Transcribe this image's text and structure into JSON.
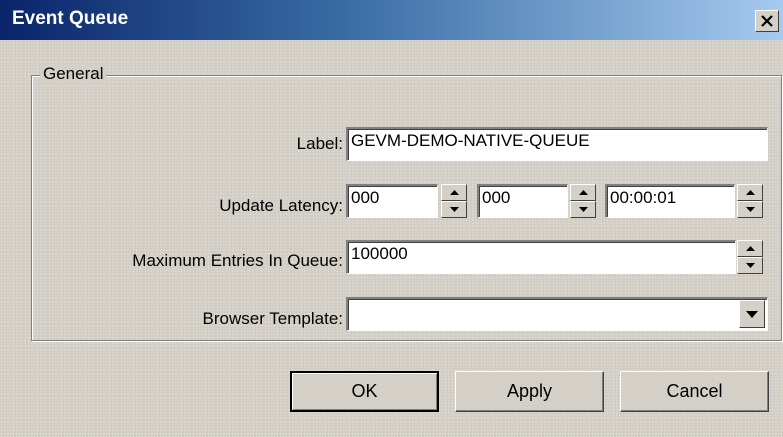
{
  "window": {
    "title": "Event Queue",
    "close_glyph": "✕"
  },
  "group": {
    "legend": "General"
  },
  "fields": {
    "label": {
      "label": "Label:",
      "value": "GEVM-DEMO-NATIVE-QUEUE"
    },
    "update_latency": {
      "label": "Update Latency:",
      "values": [
        "000",
        "000",
        "00:00:01"
      ]
    },
    "max_entries": {
      "label": "Maximum Entries In Queue:",
      "value": "100000"
    },
    "browser_template": {
      "label": "Browser Template:",
      "value": ""
    }
  },
  "buttons": {
    "ok": "OK",
    "apply": "Apply",
    "cancel": "Cancel"
  },
  "icons": {
    "spin_up": "up-arrow-icon",
    "spin_down": "down-arrow-icon",
    "dropdown": "chevron-down-icon",
    "close": "close-icon"
  },
  "colors": {
    "title_start": "#0a246a",
    "title_end": "#a6caf0",
    "face": "#d4d0c8"
  }
}
